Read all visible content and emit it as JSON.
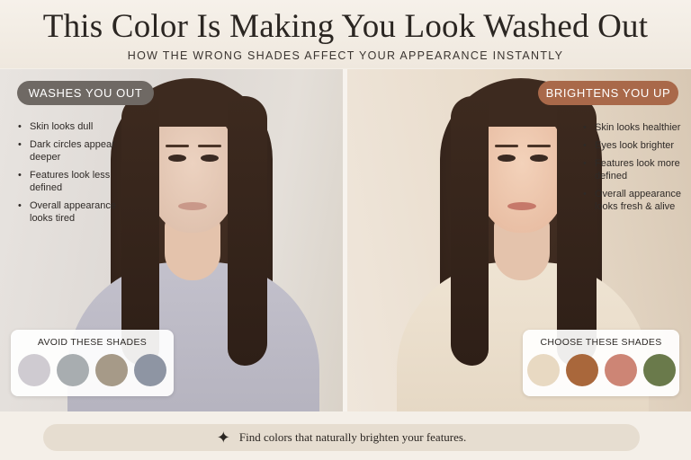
{
  "header": {
    "title": "This Color Is Making You Look Washed Out",
    "subtitle": "HOW THE WRONG SHADES AFFECT YOUR APPEARANCE INSTANTLY"
  },
  "left_panel": {
    "label": "WASHES YOU OUT",
    "bullets": [
      "Skin looks dull",
      "Dark circles appear deeper",
      "Features look less defined",
      "Overall appearance looks tired"
    ],
    "card_title": "AVOID THESE SHADES",
    "swatches": [
      "#cfcbd1",
      "#a8adb0",
      "#a69a88",
      "#8e95a3"
    ]
  },
  "right_panel": {
    "label": "BRIGHTENS YOU UP",
    "bullets": [
      "Skin looks healthier",
      "Eyes look brighter",
      "Features look more defined",
      "Overall appearance looks fresh & alive"
    ],
    "card_title": "CHOOSE THESE SHADES",
    "swatches": [
      "#e8d9c2",
      "#a9673b",
      "#cd8575",
      "#6a7a4b"
    ]
  },
  "footer": {
    "icon": "sparkle-icon",
    "text": "Find colors that naturally brighten your features."
  }
}
